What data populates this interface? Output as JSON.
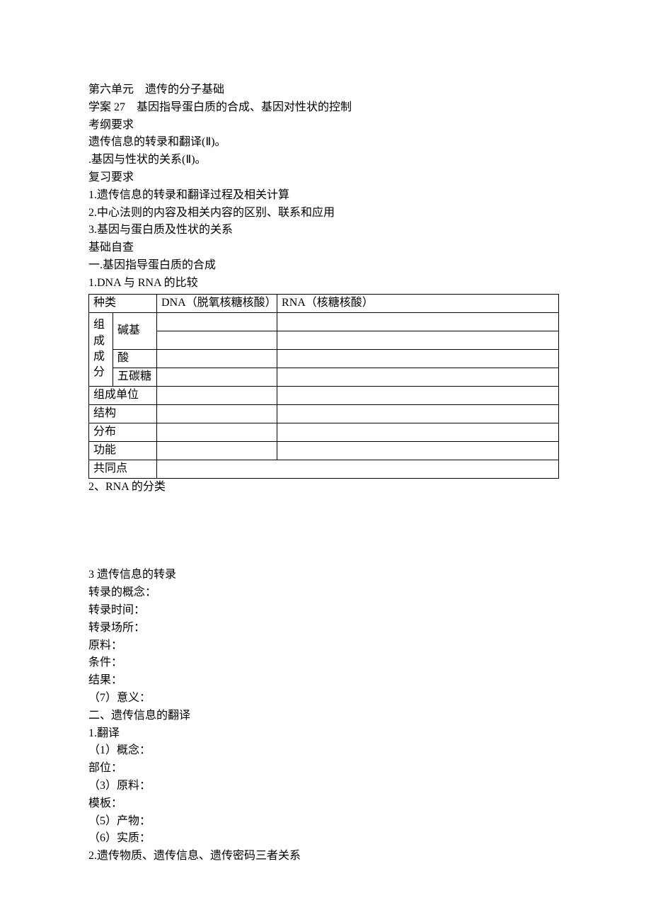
{
  "unit_title": "第六单元　遗传的分子基础",
  "lesson_title": "学案 27　基因指导蛋白质的合成、基因对性状的控制",
  "sec_examreq_title": "考纲要求",
  "examreq_1": "遗传信息的转录和翻译(Ⅱ)。",
  "examreq_2": ".基因与性状的关系(Ⅱ)。",
  "sec_review_title": "复习要求",
  "review_1": "1.遗传信息的转录和翻译过程及相关计算",
  "review_2": "2.中心法则的内容及相关内容的区别、联系和应用",
  "review_3": "3.基因与蛋白质及性状的关系",
  "sec_basic_title": "基础自查",
  "sec_one_title": "一.基因指导蛋白质的合成",
  "q1_title": "1.DNA 与 RNA 的比较",
  "table": {
    "h_type": "种类",
    "h_dna": "DNA（脱氧核糖核酸）",
    "h_rna": "RNA（核糖核酸）",
    "r_comp": "组成成分",
    "r_base": "碱基",
    "r_acid": "酸",
    "r_sugar": "五碳糖",
    "r_unit": "组成单位",
    "r_struct": "结构",
    "r_dist": "分布",
    "r_func": "功能",
    "r_common": "共同点",
    "cell_base_dna_1": "",
    "cell_base_dna_2": "",
    "cell_base_rna_1": "",
    "cell_base_rna_2": "",
    "cell_acid_dna": "",
    "cell_acid_rna": "",
    "cell_sugar_dna": "",
    "cell_sugar_rna": "",
    "cell_unit_dna": "",
    "cell_unit_rna": "",
    "cell_struct_dna": "",
    "cell_struct_rna": "",
    "cell_dist_dna": "",
    "cell_dist_rna": "",
    "cell_func_dna": "",
    "cell_func_rna": "",
    "cell_common": ""
  },
  "q2_title": "2、RNA 的分类",
  "q3_title": "3 遗传信息的转录",
  "q3_l1": "转录的概念：",
  "q3_l2": "转录时间：",
  "q3_l3": "转录场所：",
  "q3_l4": "原料：",
  "q3_l5": "条件：",
  "q3_l6": "结果：",
  "q3_l7": "（7）意义：",
  "sec_two_title": "二、遗传信息的翻译",
  "t1_title": "1.翻译",
  "t1_l1": "（1）概念：",
  "t1_l2": "部位：",
  "t1_l3": "（3）原料：",
  "t1_l4": "模板：",
  "t1_l5": "（5）产物：",
  "t1_l6": "（6）实质：",
  "t2_title": "2.遗传物质、遗传信息、遗传密码三者关系"
}
